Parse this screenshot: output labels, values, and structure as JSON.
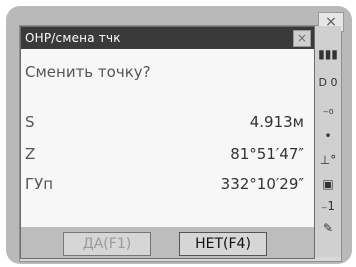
{
  "dialog": {
    "title": "ОНР/смена тчк",
    "close_glyph": "×",
    "prompt": "Сменить точку?",
    "rows": [
      {
        "label": "S",
        "value": "4.913м"
      },
      {
        "label": "Z",
        "value": "81°51′47″"
      },
      {
        "label": "ГУп",
        "value": "332°10′29″"
      }
    ],
    "buttons": {
      "yes": "ДА(F1)",
      "no": "НЕТ(F4)"
    }
  },
  "screen": {
    "top_close_glyph": "×"
  },
  "sidebar": {
    "items": [
      {
        "icon": "battery-icon",
        "glyph": "▮▮▮"
      },
      {
        "icon": "counter-icon",
        "glyph": "D  0"
      },
      {
        "icon": "prism-constant-icon",
        "glyph": "₋₀"
      },
      {
        "icon": "dot-icon",
        "glyph": "•"
      },
      {
        "icon": "tilt-icon",
        "glyph": "⊥°"
      },
      {
        "icon": "memory-icon",
        "glyph": "▣"
      },
      {
        "icon": "level-icon",
        "glyph": "₋1"
      },
      {
        "icon": "pen-icon",
        "glyph": "✎"
      }
    ]
  }
}
